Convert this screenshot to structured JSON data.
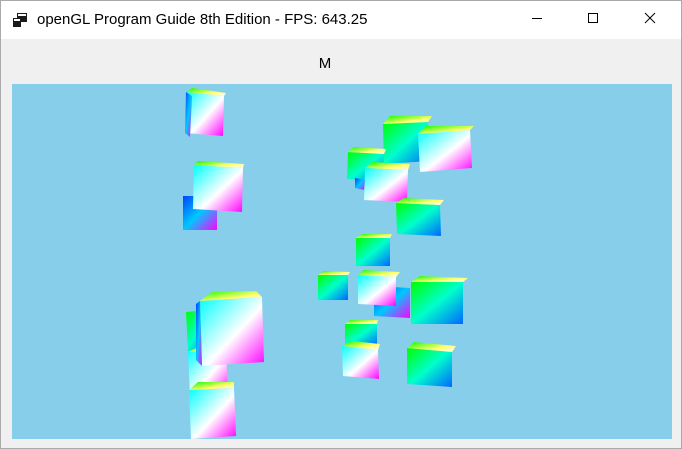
{
  "window": {
    "title": "openGL Program Guide 8th Edition - FPS: 643.25",
    "app_icon": "app-window-icon",
    "controls": {
      "minimize_icon": "minimize-icon",
      "maximize_icon": "maximize-icon",
      "close_icon": "close-icon"
    }
  },
  "toolbar": {
    "button_label": "M"
  },
  "viewport": {
    "background_color": "#87ceeb",
    "scene": "rotating-color-cubes"
  }
}
